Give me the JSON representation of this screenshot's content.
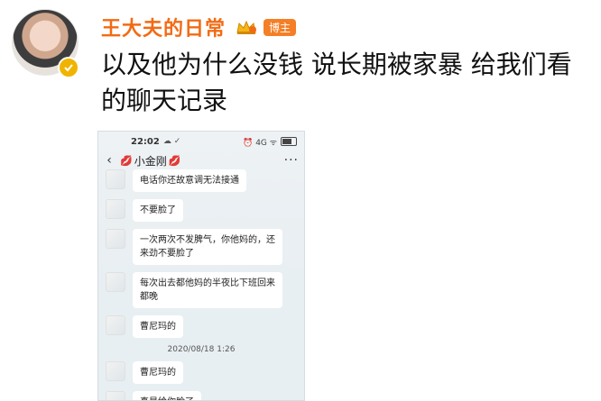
{
  "post": {
    "username": "王大夫的日常",
    "author_tag": "博主",
    "text": "以及他为什么没钱 说长期被家暴 给我们看的聊天记录"
  },
  "screenshot": {
    "status": {
      "time": "22:02",
      "left_icons": "☁ ✓",
      "right_icons": "⏰ 4G ᯤ",
      "battery": "59"
    },
    "chat_title": "小金刚",
    "messages": [
      {
        "text": "电话你还故意调无法接通"
      },
      {
        "text": "不要脸了"
      },
      {
        "text": "一次两次不发脾气，你他妈的，还来劲不要脸了"
      },
      {
        "text": "每次出去都他妈的半夜比下班回来都晚"
      },
      {
        "text": "曹尼玛的"
      },
      {
        "timestamp": "2020/08/18 1:26"
      },
      {
        "text": "曹尼玛的"
      },
      {
        "text": "真是给你脸了"
      }
    ]
  },
  "colors": {
    "username": "#f26b14",
    "author_tag_bg": "#f57f26",
    "verified_badge": "#f0b400"
  },
  "icons": [
    "avatar",
    "verified-badge-icon",
    "crown-icon",
    "back-icon",
    "lips-icon",
    "more-icon"
  ]
}
